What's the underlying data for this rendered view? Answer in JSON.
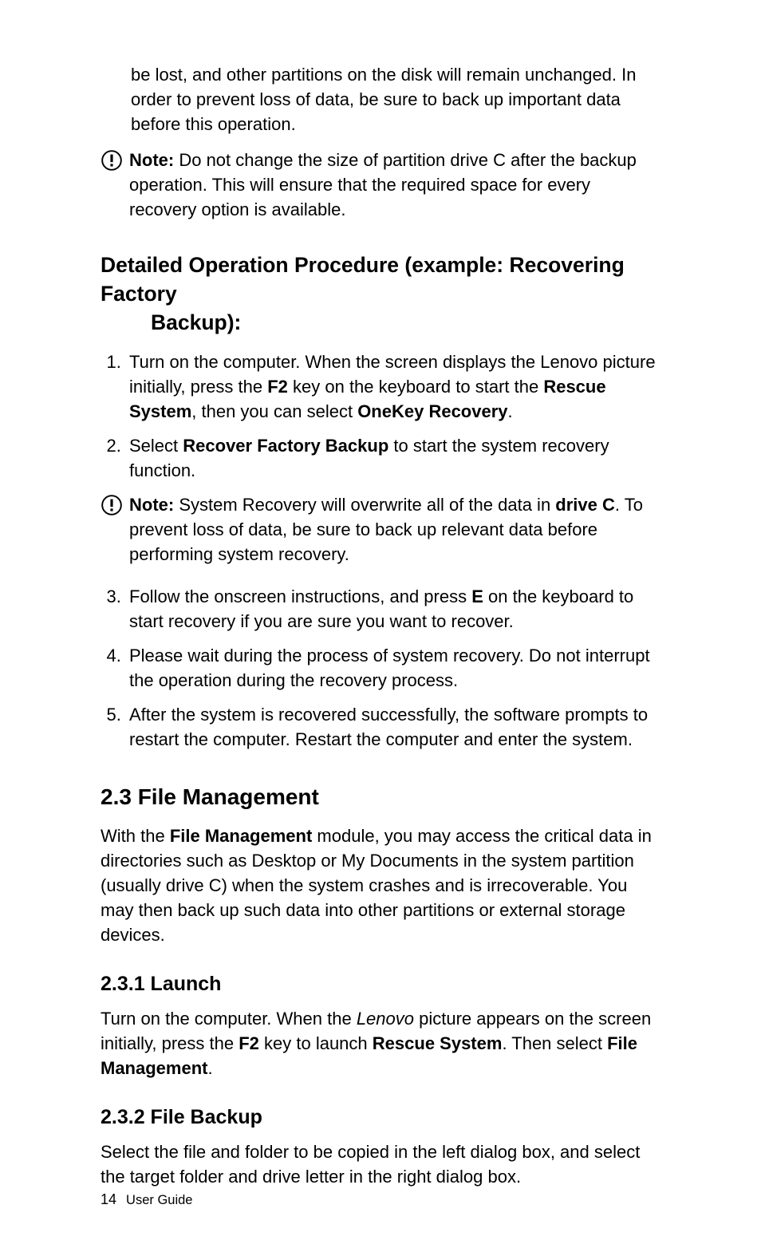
{
  "para_top": "be lost, and other partitions on the disk will remain unchanged. In order to prevent loss of data, be sure to back up important data before this operation.",
  "note1": {
    "label": "Note:",
    "text": " Do not change the size of partition drive C after the backup operation. This will ensure that the required space for every recovery option is available."
  },
  "h2": {
    "line1": "Detailed Operation Procedure (example: Recovering Factory",
    "line2": "Backup):"
  },
  "steps": {
    "s1_a": "Turn on the computer. When the screen displays the Lenovo picture initially, press the ",
    "s1_b": "F2",
    "s1_c": " key on the keyboard to start the ",
    "s1_d": "Rescue System",
    "s1_e": ", then you can select ",
    "s1_f": "OneKey Recovery",
    "s1_g": ".",
    "s2_a": "Select ",
    "s2_b": "Recover Factory Backup",
    "s2_c": " to start the system recovery function.",
    "s3_a": "Follow the onscreen instructions, and press ",
    "s3_b": "E",
    "s3_c": " on the keyboard to start recovery if you are sure you want to recover.",
    "s4": "Please wait during the process of system recovery. Do not interrupt the operation during the recovery process.",
    "s5": "After the system is recovered successfully, the software prompts to restart the computer. Restart the computer and enter the system."
  },
  "note2": {
    "label": "Note:",
    "text_a": " System Recovery will overwrite all of the data in ",
    "bold": "drive C",
    "text_b": ". To prevent loss of data, be sure to back up relevant data before performing system recovery."
  },
  "section_2_3": {
    "title": "2.3 File Management",
    "p_a": "With the ",
    "p_b": "File Management",
    "p_c": " module, you may access the critical data in directories such as Desktop or My Documents in the system partition (usually drive C) when the system crashes and is irrecoverable. You may then back up such data into other partitions or external storage devices."
  },
  "section_231": {
    "title": "2.3.1 Launch",
    "p_a": "Turn on the computer. When the ",
    "p_em": "Lenovo",
    "p_b": " picture appears on the screen initially, press the ",
    "p_c": "F2",
    "p_d": " key to launch ",
    "p_e": "Rescue System",
    "p_f": ". Then select ",
    "p_g": "File Management",
    "p_h": "."
  },
  "section_232": {
    "title": "2.3.2 File Backup",
    "p": "Select the file and folder to be copied in the left dialog box, and select the target folder and drive letter in the right dialog box."
  },
  "footer": {
    "num": "14",
    "label": "User Guide"
  }
}
